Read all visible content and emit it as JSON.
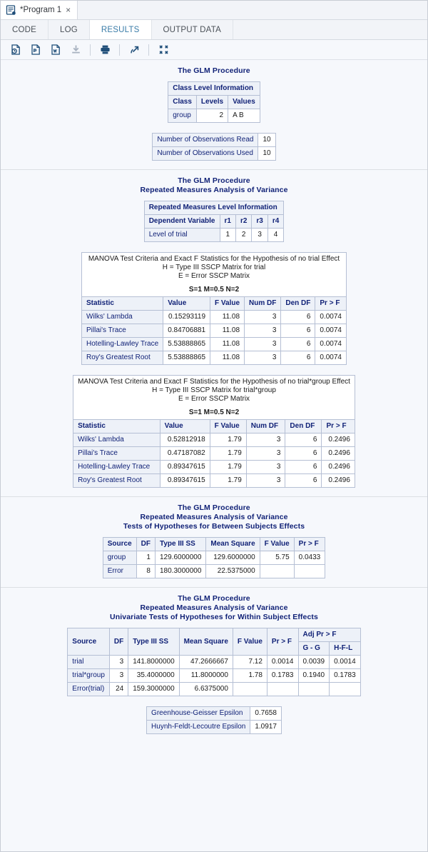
{
  "window": {
    "tab_title": "*Program 1",
    "tab_close": "×",
    "tab_icon": "sas-program-icon"
  },
  "view_tabs": [
    {
      "label": "CODE",
      "active": false
    },
    {
      "label": "LOG",
      "active": false
    },
    {
      "label": "RESULTS",
      "active": true
    },
    {
      "label": "OUTPUT DATA",
      "active": false
    }
  ],
  "toolbar": {
    "buttons": [
      {
        "name": "export-html-icon",
        "title": "Download results as HTML"
      },
      {
        "name": "export-pdf-icon",
        "title": "Download results as PDF"
      },
      {
        "name": "export-word-icon",
        "title": "Download results as Word"
      },
      {
        "name": "download-icon",
        "title": "Download",
        "disabled": true
      },
      {
        "name": "print-icon",
        "title": "Print"
      },
      {
        "name": "open-in-new-window-icon",
        "title": "Open in new window"
      },
      {
        "name": "collapse-icon",
        "title": "Collapse"
      }
    ]
  },
  "sections": {
    "s1": {
      "title": "The GLM Procedure",
      "class_level": {
        "caption": "Class Level Information",
        "headers": [
          "Class",
          "Levels",
          "Values"
        ],
        "rows": [
          [
            "group",
            "2",
            "A B"
          ]
        ]
      },
      "obs": {
        "rows": [
          [
            "Number of Observations Read",
            "10"
          ],
          [
            "Number of Observations Used",
            "10"
          ]
        ]
      }
    },
    "s2": {
      "title_line1": "The GLM Procedure",
      "title_line2": "Repeated Measures Analysis of Variance",
      "level_info": {
        "caption": "Repeated Measures Level Information",
        "rows": [
          [
            "Dependent Variable",
            "r1",
            "r2",
            "r3",
            "r4"
          ],
          [
            "Level of trial",
            "1",
            "2",
            "3",
            "4"
          ]
        ]
      },
      "manova_trial": {
        "banner_line1": "MANOVA Test Criteria and Exact F Statistics for the Hypothesis of no trial Effect",
        "banner_line2": "H = Type III SSCP Matrix for trial",
        "banner_line3": "E = Error SSCP Matrix",
        "banner_line4": "S=1 M=0.5 N=2",
        "headers": [
          "Statistic",
          "Value",
          "F Value",
          "Num DF",
          "Den DF",
          "Pr > F"
        ],
        "rows": [
          [
            "Wilks' Lambda",
            "0.15293119",
            "11.08",
            "3",
            "6",
            "0.0074"
          ],
          [
            "Pillai's Trace",
            "0.84706881",
            "11.08",
            "3",
            "6",
            "0.0074"
          ],
          [
            "Hotelling-Lawley Trace",
            "5.53888865",
            "11.08",
            "3",
            "6",
            "0.0074"
          ],
          [
            "Roy's Greatest Root",
            "5.53888865",
            "11.08",
            "3",
            "6",
            "0.0074"
          ]
        ]
      },
      "manova_interaction": {
        "banner_line1": "MANOVA Test Criteria and Exact F Statistics for the Hypothesis of no trial*group Effect",
        "banner_line2": "H = Type III SSCP Matrix for trial*group",
        "banner_line3": "E = Error SSCP Matrix",
        "banner_line4": "S=1 M=0.5 N=2",
        "headers": [
          "Statistic",
          "Value",
          "F Value",
          "Num DF",
          "Den DF",
          "Pr > F"
        ],
        "rows": [
          [
            "Wilks' Lambda",
            "0.52812918",
            "1.79",
            "3",
            "6",
            "0.2496"
          ],
          [
            "Pillai's Trace",
            "0.47187082",
            "1.79",
            "3",
            "6",
            "0.2496"
          ],
          [
            "Hotelling-Lawley Trace",
            "0.89347615",
            "1.79",
            "3",
            "6",
            "0.2496"
          ],
          [
            "Roy's Greatest Root",
            "0.89347615",
            "1.79",
            "3",
            "6",
            "0.2496"
          ]
        ]
      }
    },
    "s3": {
      "title_line1": "The GLM Procedure",
      "title_line2": "Repeated Measures Analysis of Variance",
      "title_line3": "Tests of Hypotheses for Between Subjects Effects",
      "headers": [
        "Source",
        "DF",
        "Type III SS",
        "Mean Square",
        "F Value",
        "Pr > F"
      ],
      "rows": [
        [
          "group",
          "1",
          "129.6000000",
          "129.6000000",
          "5.75",
          "0.0433"
        ],
        [
          "Error",
          "8",
          "180.3000000",
          "22.5375000",
          "",
          ""
        ]
      ]
    },
    "s4": {
      "title_line1": "The GLM Procedure",
      "title_line2": "Repeated Measures Analysis of Variance",
      "title_line3": "Univariate Tests of Hypotheses for Within Subject Effects",
      "group_header": "Adj Pr > F",
      "headers": [
        "Source",
        "DF",
        "Type III SS",
        "Mean Square",
        "F Value",
        "Pr > F",
        "G - G",
        "H-F-L"
      ],
      "rows": [
        [
          "trial",
          "3",
          "141.8000000",
          "47.2666667",
          "7.12",
          "0.0014",
          "0.0039",
          "0.0014"
        ],
        [
          "trial*group",
          "3",
          "35.4000000",
          "11.8000000",
          "1.78",
          "0.1783",
          "0.1940",
          "0.1783"
        ],
        [
          "Error(trial)",
          "24",
          "159.3000000",
          "6.6375000",
          "",
          "",
          "",
          ""
        ]
      ],
      "epsilon": {
        "rows": [
          [
            "Greenhouse-Geisser Epsilon",
            "0.7658"
          ],
          [
            "Huynh-Feldt-Lecoutre Epsilon",
            "1.0917"
          ]
        ]
      }
    }
  },
  "colors": {
    "header_blue": "#112277",
    "table_header_bg": "#edf1f8",
    "active_tab_text": "#3a7ca8",
    "page_bg": "#f6f8fc",
    "icon_blue": "#1f4e79"
  }
}
